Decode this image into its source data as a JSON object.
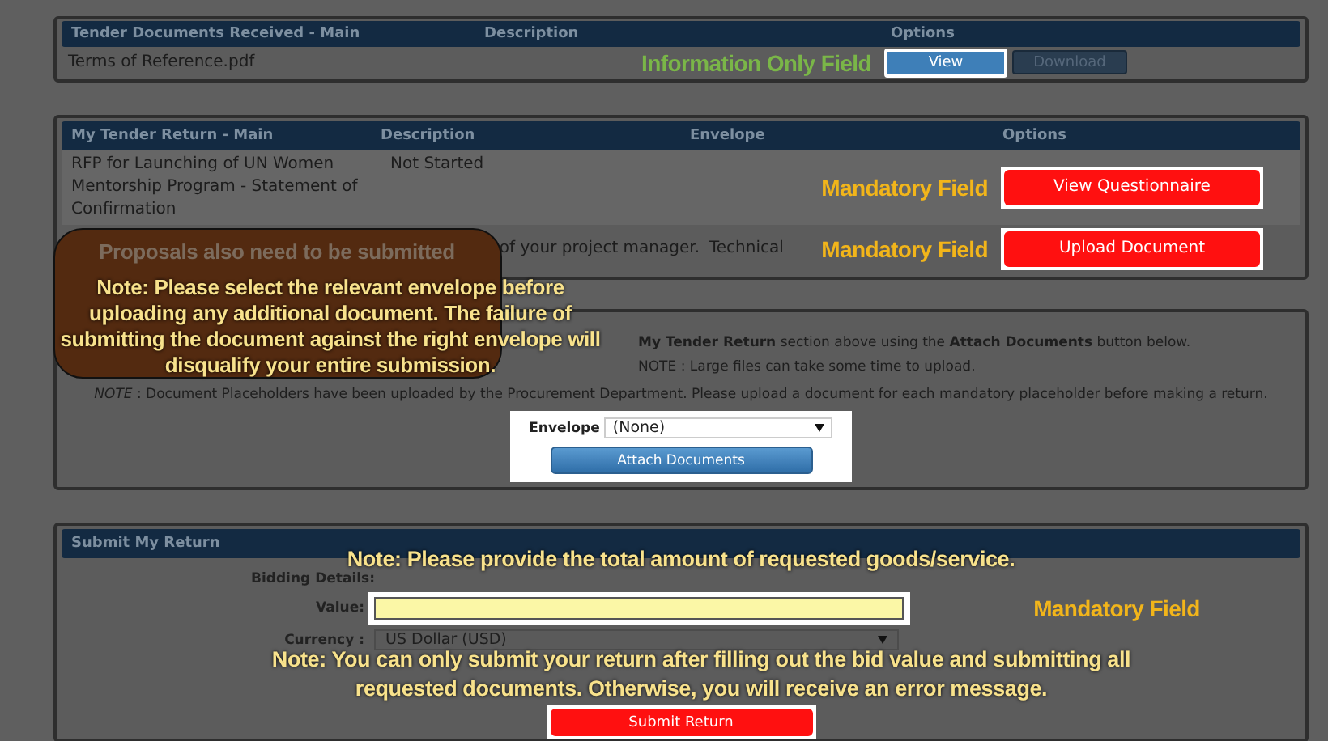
{
  "received": {
    "columns": [
      "Tender Documents Received - Main",
      "Description",
      "Options"
    ],
    "rows": [
      {
        "name": "Terms of Reference.pdf",
        "annotation": "Information Only Field",
        "actions": [
          {
            "label": "View",
            "highlighted": true
          },
          {
            "label": "Download",
            "highlighted": false
          }
        ]
      }
    ]
  },
  "returns": {
    "columns": [
      "My Tender Return - Main",
      "Description",
      "Envelope",
      "Options"
    ],
    "rows": [
      {
        "name": "RFP for Launching of UN Women Mentorship Program - Statement of Confirmation",
        "description": "Not Started",
        "annotation": "Mandatory Field",
        "action": "View Questionnaire"
      },
      {
        "description": "of your project manager.",
        "envelope": "Technical",
        "annotation": "Mandatory Field",
        "action": "Upload Document"
      }
    ]
  },
  "tooltip": "Proposals also need to be submitted",
  "envelope_note": "Note: Please select the relevant envelope before uploading any additional document. The failure of submitting the document against the right envelope will disqualify your entire submission.",
  "instructions": [
    "**My Tender Return** section above using the **Attach Documents** button below.",
    "NOTE : Large files can take some time to upload.",
    "*NOTE* : Document Placeholders have been uploaded by the Procurement Department. Please upload a document for each mandatory placeholder before making a return."
  ],
  "attach": {
    "envelope_label": "Envelope",
    "envelope_value": "(None)",
    "button": "Attach Documents"
  },
  "submit": {
    "title": "Submit My Return",
    "amount_note": "Note: Please provide the total amount of requested goods/service.",
    "bidding_label": "Bidding Details:",
    "value_label": "Value:",
    "value_annotation": "Mandatory Field",
    "currency_label": "Currency :",
    "currency": "US Dollar (USD)",
    "submit_note": "Note: You can only submit your return after filling out the bid value and submitting all requested documents. Otherwise, you will receive an error message.",
    "button": "Submit Return"
  }
}
